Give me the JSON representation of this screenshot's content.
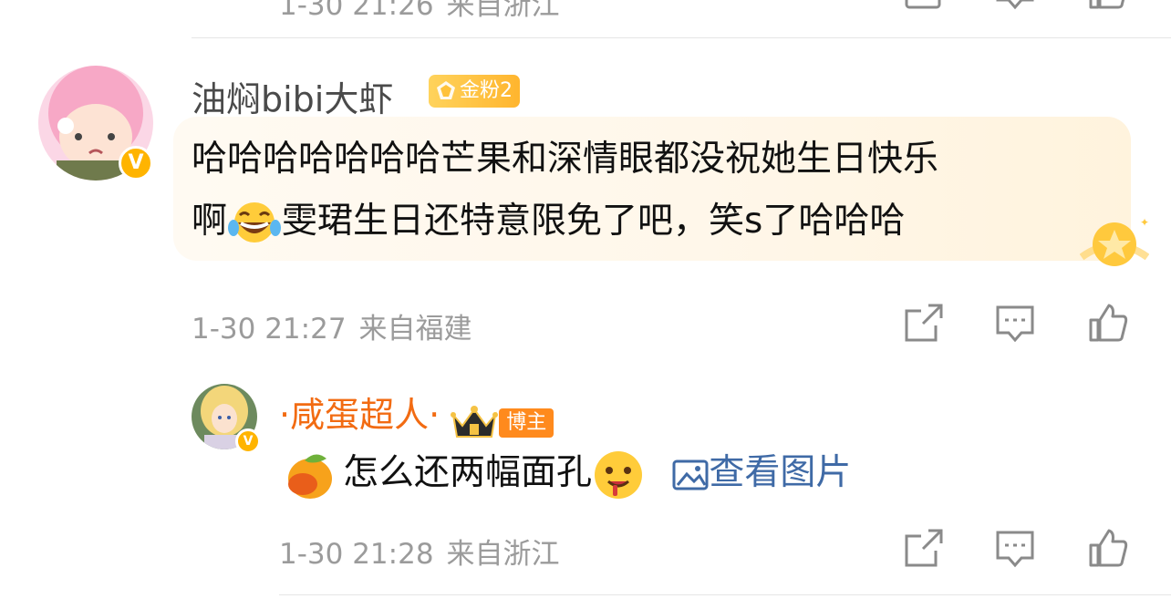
{
  "comments": [
    {
      "username": "油焖bibi大虾",
      "fan_badge": "金粉2",
      "text_line1": "哈哈哈哈哈哈哈芒果和深情眼都没祝她生日快乐",
      "text_line2_pre": "啊",
      "text_line2_post": "雯珺生日还特意限免了吧，笑s了哈哈哈",
      "emoji": "laughing-tears-emoji",
      "time": "1-30 21:27",
      "location": "来自福建"
    },
    {
      "username": "·咸蛋超人·",
      "role_badge": "博主",
      "text": "怎么还两幅面孔",
      "emoji_pre": "mango-emoji",
      "emoji_post": "drooling-face-emoji",
      "view_image": "查看图片",
      "time": "1-30 21:28",
      "location": "来自浙江"
    }
  ],
  "top_partial": {
    "time": "1-30 21:26",
    "location": "来自浙江"
  },
  "verified_mark": "V",
  "colors": {
    "accent_orange": "#f26b12",
    "gold": "#ffb400",
    "link": "#3f6aa6",
    "meta": "#9b9b9b"
  },
  "icons": [
    "share-icon",
    "comment-icon",
    "like-icon",
    "verified-icon",
    "crown-icon",
    "image-icon"
  ]
}
